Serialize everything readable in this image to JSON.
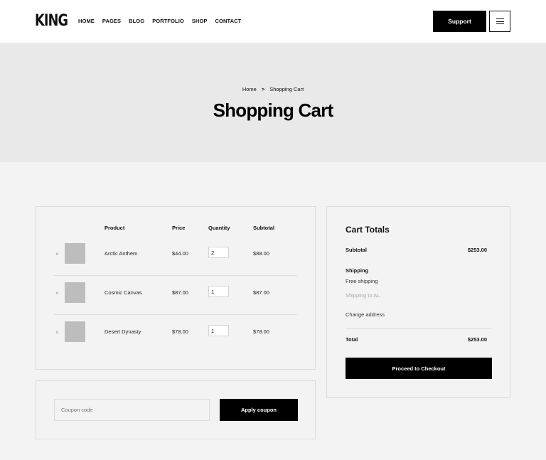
{
  "header": {
    "logo": "KING",
    "nav": [
      "HOME",
      "PAGES",
      "BLOG",
      "PORTFOLIO",
      "SHOP",
      "CONTACT"
    ],
    "support_label": "Support",
    "menu_icon": "hamburger-icon"
  },
  "hero": {
    "breadcrumb": {
      "home": "Home",
      "separator": ">",
      "current": "Shopping Cart"
    },
    "title": "Shopping Cart"
  },
  "cart": {
    "headers": {
      "product": "Product",
      "price": "Price",
      "quantity": "Quantity",
      "subtotal": "Subtotal"
    },
    "remove_symbol": "×",
    "items": [
      {
        "name": "Arctic Anthem",
        "price": "$44.00",
        "quantity": "2",
        "subtotal": "$88.00"
      },
      {
        "name": "Cosmic Canvas",
        "price": "$87.00",
        "quantity": "1",
        "subtotal": "$87.00"
      },
      {
        "name": "Desert Dynasty",
        "price": "$78.00",
        "quantity": "1",
        "subtotal": "$78.00"
      }
    ]
  },
  "coupon": {
    "placeholder": "Coupon code",
    "apply_label": "Apply coupon"
  },
  "totals": {
    "title": "Cart Totals",
    "subtotal_label": "Subtotal",
    "subtotal_value": "$253.00",
    "shipping_label": "Shipping",
    "shipping_method": "Free shipping",
    "shipping_to": "Shipping to AL.",
    "change_address": "Change address",
    "total_label": "Total",
    "total_value": "$253.00",
    "checkout_label": "Proceed to Checkout"
  },
  "colors": {
    "accent": "#000000",
    "page_background": "#f3f3f3",
    "hero_background": "#e9e9e9",
    "header_background": "#ffffff",
    "thumbnail_placeholder": "#bdbdbd"
  }
}
